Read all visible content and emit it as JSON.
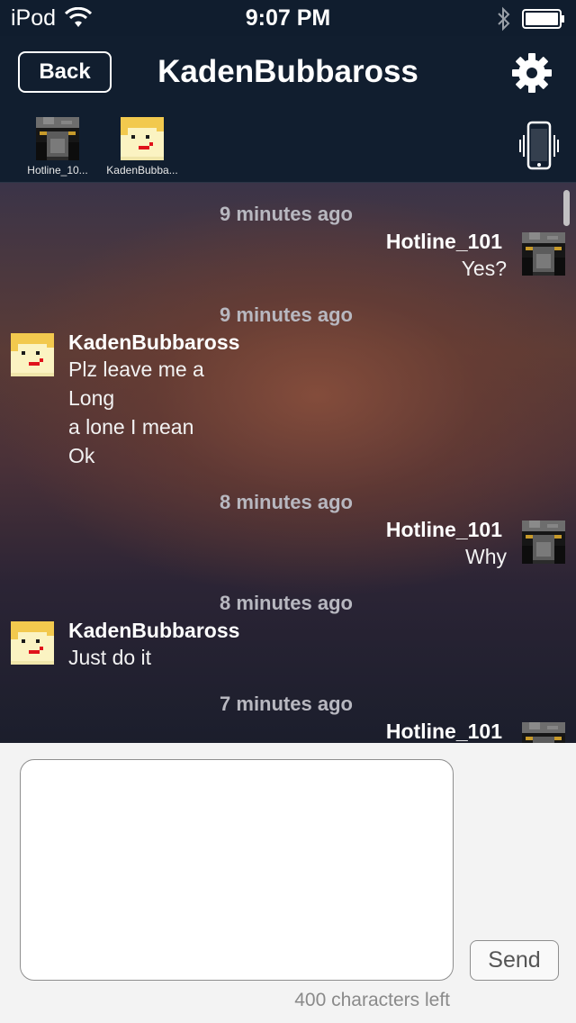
{
  "status_bar": {
    "device": "iPod",
    "time": "9:07 PM"
  },
  "header": {
    "back_label": "Back",
    "title": "KadenBubbaross",
    "settings_icon": "gear-icon"
  },
  "participants": [
    {
      "name": "Hotline_10...",
      "avatar": "dark-pixel-avatar"
    },
    {
      "name": "KadenBubba...",
      "avatar": "blond-pixel-avatar"
    }
  ],
  "vibrate_icon": "phone-vibrate-icon",
  "messages": [
    {
      "time": "9 minutes ago",
      "side": "right",
      "sender": "Hotline_101",
      "lines": [
        "Yes?"
      ]
    },
    {
      "time": "9 minutes ago",
      "side": "left",
      "sender": "KadenBubbaross",
      "lines": [
        "Plz leave me a",
        "Long",
        "a lone I mean",
        "Ok"
      ]
    },
    {
      "time": "8 minutes ago",
      "side": "right",
      "sender": "Hotline_101",
      "lines": [
        "Why"
      ]
    },
    {
      "time": "8 minutes ago",
      "side": "left",
      "sender": "KadenBubbaross",
      "lines": [
        "Just do it"
      ]
    },
    {
      "time": "7 minutes ago",
      "side": "right",
      "sender": "Hotline_101",
      "lines": []
    }
  ],
  "composer": {
    "input_value": "",
    "send_label": "Send",
    "chars_left": "400 characters left"
  },
  "colors": {
    "header_bg": "#111e2f",
    "timestamp": "#b8b8c0",
    "composer_bg": "#f3f3f3"
  }
}
